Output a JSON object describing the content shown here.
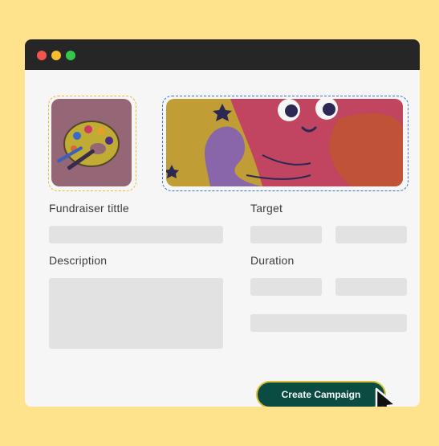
{
  "window": {
    "controls": [
      "close",
      "minimize",
      "maximize"
    ]
  },
  "form": {
    "thumbnail_icon": "paint-palette-icon",
    "banner_image": "monster-illustration",
    "fundraiser_title_label": "Fundraiser tittle",
    "target_label": "Target",
    "description_label": "Description",
    "duration_label": "Duration",
    "submit_label": "Create Campaign"
  },
  "colors": {
    "background": "#FFE38C",
    "titlebar": "#262626",
    "button": "#0B4F45",
    "button_border": "#E2C53B",
    "field": "#EBEBEB"
  }
}
